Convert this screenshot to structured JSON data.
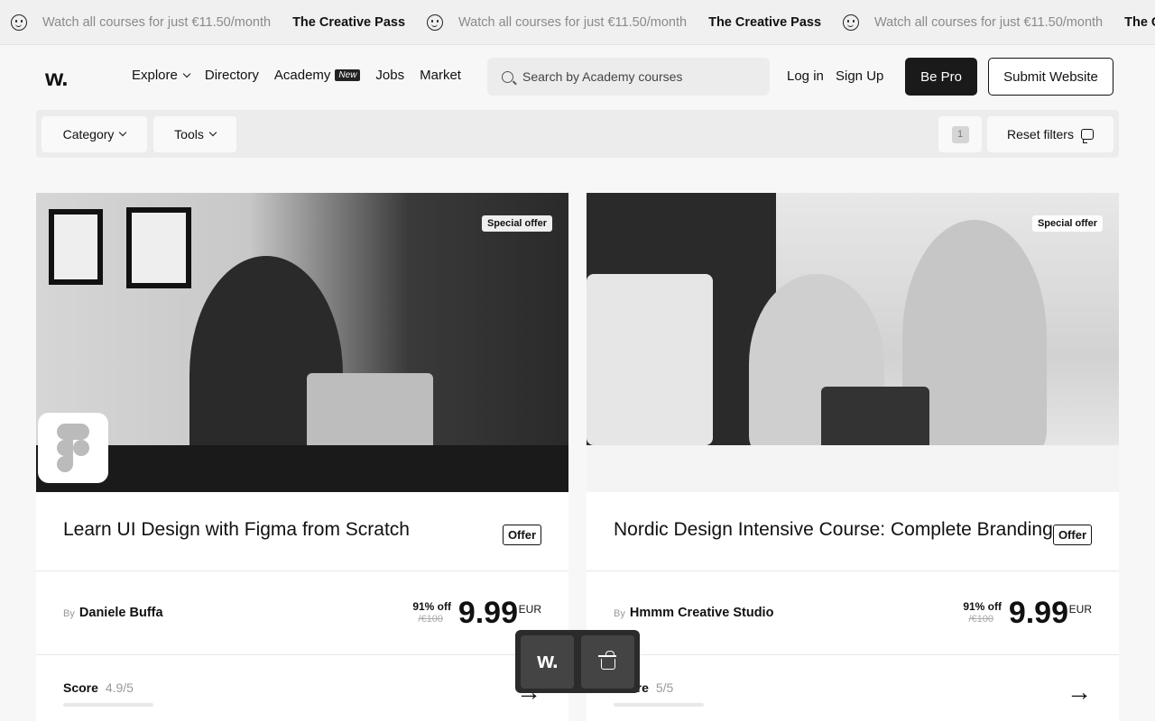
{
  "announcement": {
    "promo_text": "Watch all courses for just €11.50/month",
    "brand": "The Creative Pass",
    "icon": "smiley-icon"
  },
  "header": {
    "logo": "w.",
    "nav": {
      "explore": "Explore",
      "directory": "Directory",
      "academy": "Academy",
      "academy_badge": "New",
      "jobs": "Jobs",
      "market": "Market"
    },
    "search": {
      "placeholder": "Search by Academy courses",
      "value": ""
    },
    "login": "Log in",
    "signup": "Sign Up",
    "be_pro": "Be Pro",
    "submit_website": "Submit Website"
  },
  "filters": {
    "category": "Category",
    "tools": "Tools",
    "active_count": "1",
    "reset": "Reset filters"
  },
  "courses": [
    {
      "badge": "Special offer",
      "title": "Learn UI Design with Figma from Scratch",
      "tag": "Offer",
      "by_label": "By",
      "author": "Daniele Buffa",
      "discount": "91% off",
      "old_price": "/€100",
      "price": "9.99",
      "currency": "EUR",
      "score_label": "Score",
      "score": "4.9/5",
      "score_fill": 0.98
    },
    {
      "badge": "Special offer",
      "title": "Nordic Design Intensive Course: Complete Branding",
      "tag": "Offer",
      "by_label": "By",
      "author": "Hmmm Creative Studio",
      "discount": "91% off",
      "old_price": "/€100",
      "price": "9.99",
      "currency": "EUR",
      "score_label": "Score",
      "score": "5/5",
      "score_fill": 1.0
    }
  ],
  "dock": {
    "logo": "w.",
    "cart_icon": "basket-icon"
  }
}
